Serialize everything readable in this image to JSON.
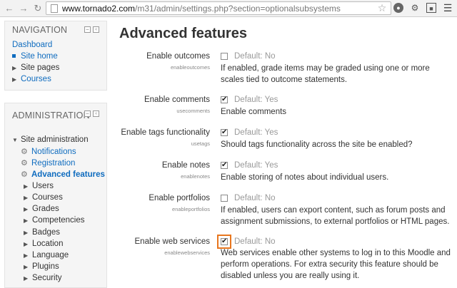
{
  "browser": {
    "url_host": "www.tornado2.com",
    "url_path": "/m31/admin/settings.php?section=optionalsubsystems"
  },
  "nav_block": {
    "title": "NAVIGATION",
    "items": [
      {
        "label": "Dashboard"
      },
      {
        "label": "Site home"
      },
      {
        "label": "Site pages"
      },
      {
        "label": "Courses"
      }
    ]
  },
  "admin_block": {
    "title": "ADMINISTRATION",
    "root": "Site administration",
    "items": [
      {
        "label": "Notifications"
      },
      {
        "label": "Registration"
      },
      {
        "label": "Advanced features"
      },
      {
        "label": "Users"
      },
      {
        "label": "Courses"
      },
      {
        "label": "Grades"
      },
      {
        "label": "Competencies"
      },
      {
        "label": "Badges"
      },
      {
        "label": "Location"
      },
      {
        "label": "Language"
      },
      {
        "label": "Plugins"
      },
      {
        "label": "Security"
      }
    ]
  },
  "main": {
    "title": "Advanced features",
    "settings": [
      {
        "label": "Enable outcomes",
        "key": "enableoutcomes",
        "checked": false,
        "default": "Default: No",
        "desc": "If enabled, grade items may be graded using one or more scales tied to outcome statements."
      },
      {
        "label": "Enable comments",
        "key": "usecomments",
        "checked": true,
        "default": "Default: Yes",
        "desc": "Enable comments"
      },
      {
        "label": "Enable tags functionality",
        "key": "usetags",
        "checked": true,
        "default": "Default: Yes",
        "desc": "Should tags functionality across the site be enabled?"
      },
      {
        "label": "Enable notes",
        "key": "enablenotes",
        "checked": true,
        "default": "Default: Yes",
        "desc": "Enable storing of notes about individual users."
      },
      {
        "label": "Enable portfolios",
        "key": "enableportfolios",
        "checked": false,
        "default": "Default: No",
        "desc": "If enabled, users can export content, such as forum posts and assignment submissions, to external portfolios or HTML pages."
      },
      {
        "label": "Enable web services",
        "key": "enablewebservices",
        "checked": true,
        "default": "Default: No",
        "desc": "Web services enable other systems to log in to this Moodle and perform operations. For extra security this feature should be disabled unless you are really using it."
      }
    ]
  }
}
